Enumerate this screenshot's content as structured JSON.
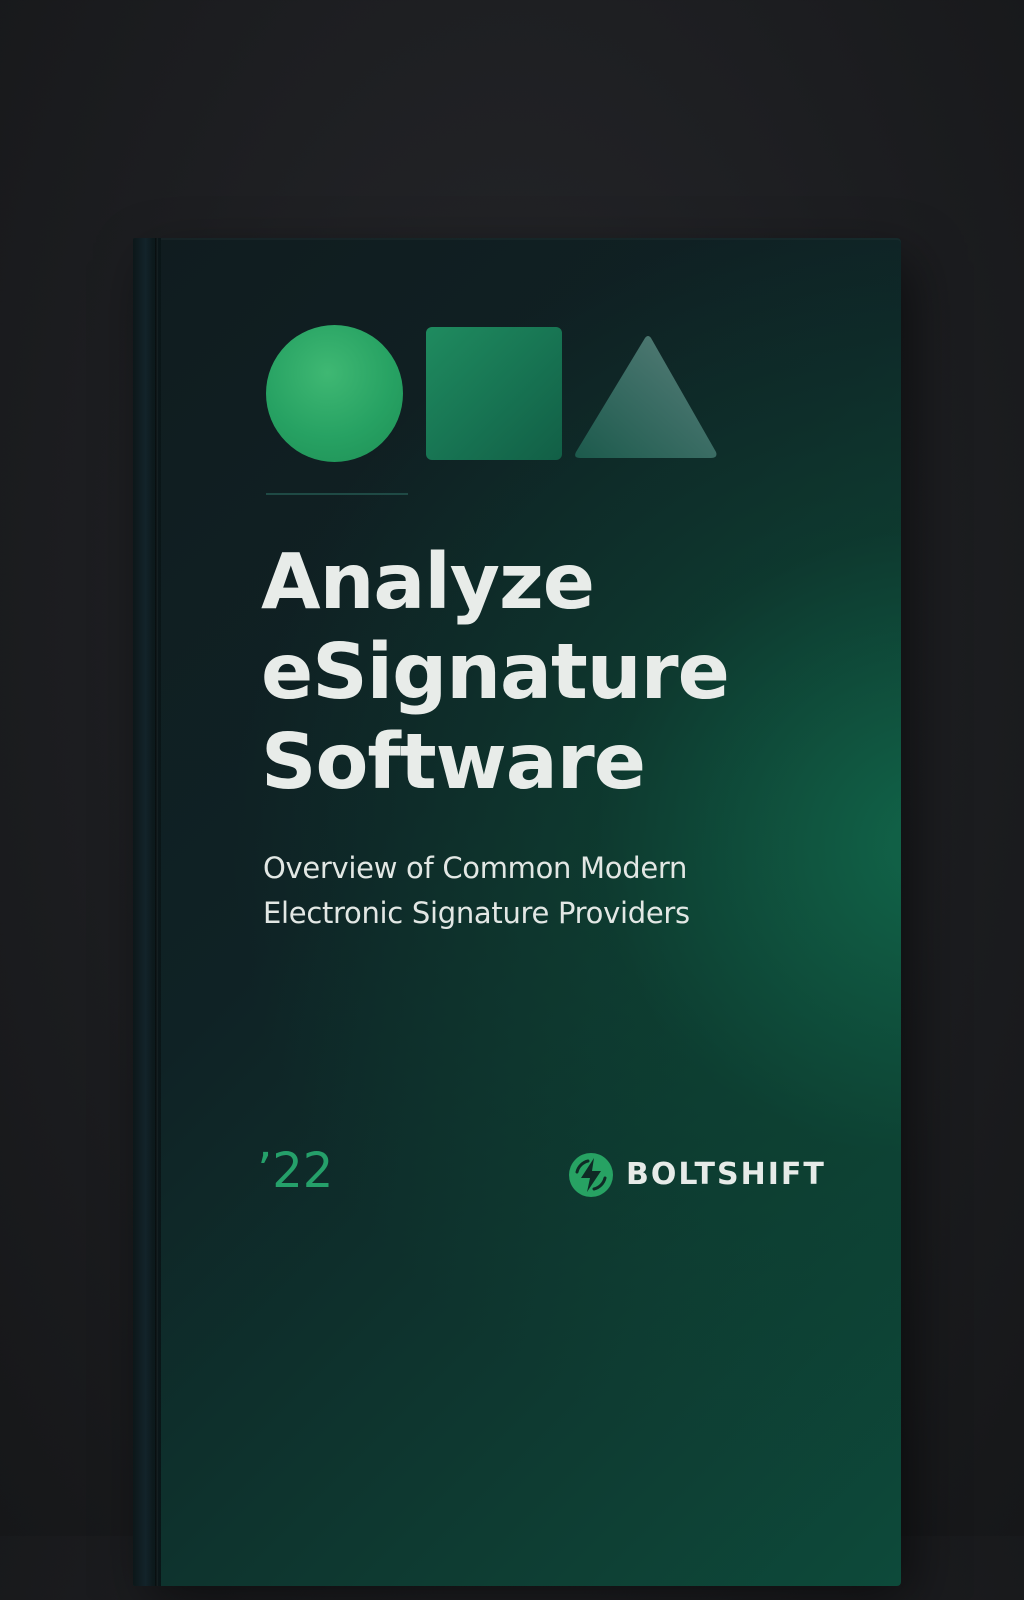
{
  "cover": {
    "title_lines": [
      "Analyze",
      "eSignature",
      "Software"
    ],
    "subtitle_lines": [
      "Overview of Common Modern",
      "Electronic Signature Providers"
    ],
    "year": "’22",
    "brand": "BOLTSHIFT"
  },
  "colors": {
    "accent_green": "#27a263",
    "cover_dark": "#101c1f",
    "text_light": "#e8ece9",
    "year_green": "#25a06a"
  },
  "icons": {
    "shapes": [
      "circle-icon",
      "square-icon",
      "triangle-icon"
    ],
    "logo": "bolt-logo-icon"
  }
}
